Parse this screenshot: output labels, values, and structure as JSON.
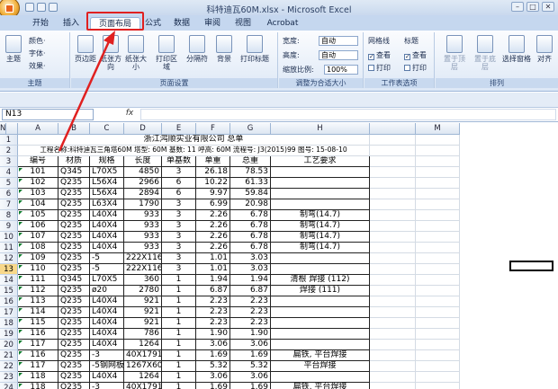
{
  "window": {
    "title": "科特迪瓦60M.xlsx - Microsoft Excel",
    "minimize": "–",
    "maximize": "□",
    "close": "✕"
  },
  "tabs": [
    "开始",
    "插入",
    "页面布局",
    "公式",
    "数据",
    "审阅",
    "视图",
    "Acrobat"
  ],
  "active_tab": "页面布局",
  "ribbon": {
    "theme": {
      "big": "主题",
      "colors": "颜色·",
      "fonts": "字体·",
      "effects": "效果·",
      "label": "主题"
    },
    "page_setup": {
      "margins": "页边距",
      "orientation": "纸张方向",
      "size": "纸张大小",
      "print_area": "打印区域",
      "breaks": "分隔符",
      "background": "背景",
      "print_titles": "打印标题",
      "label": "页面设置"
    },
    "scale": {
      "width_label": "宽度:",
      "width_value": "自动",
      "height_label": "高度:",
      "height_value": "自动",
      "zoom_label": "缩放比例:",
      "zoom_value": "100%",
      "label": "调整为合适大小"
    },
    "sheet_options": {
      "gridlines": "网格线",
      "headings": "标题",
      "view": "查看",
      "print": "打印",
      "label": "工作表选项"
    },
    "arrange": {
      "bring_forward": "置于顶层",
      "send_backward": "置于底层",
      "selection_pane": "选择窗格",
      "align": "对齐",
      "label": "排列"
    }
  },
  "formula_bar": {
    "name_box": "N13",
    "fx": "fx",
    "content": ""
  },
  "sheet": {
    "col_headers": [
      "A",
      "B",
      "C",
      "D",
      "E",
      "F",
      "G",
      "H",
      "",
      "M",
      "N"
    ],
    "row_headers": [
      "1",
      "2",
      "3",
      "4",
      "5",
      "6",
      "7",
      "8",
      "9",
      "10",
      "11",
      "12",
      "13",
      "14",
      "15",
      "16",
      "17",
      "18",
      "19",
      "20",
      "21",
      "22",
      "23",
      "24"
    ],
    "title": "浙江鸿顺实业有限公司   总单",
    "info": "工程名称:科特迪瓦三角塔60M  塔型: 60M 基数: 11 呼高: 60M 流程号: J3(2015)99 图号: 15-08-10",
    "headers": [
      "编号",
      "材质",
      "规格",
      "长度",
      "单基数",
      "单重",
      "总重",
      "工艺要求"
    ],
    "rows": [
      [
        "101",
        "Q345",
        "L70X5",
        "4850",
        "3",
        "26.18",
        "78.53",
        ""
      ],
      [
        "102",
        "Q235",
        "L56X4",
        "2966",
        "6",
        "10.22",
        "61.33",
        ""
      ],
      [
        "103",
        "Q235",
        "L56X4",
        "2894",
        "6",
        "9.97",
        "59.84",
        ""
      ],
      [
        "104",
        "Q235",
        "L63X4",
        "1790",
        "3",
        "6.99",
        "20.98",
        ""
      ],
      [
        "105",
        "Q235",
        "L40X4",
        "933",
        "3",
        "2.26",
        "6.78",
        "制弯(14.7)"
      ],
      [
        "106",
        "Q235",
        "L40X4",
        "933",
        "3",
        "2.26",
        "6.78",
        "制弯(14.7)"
      ],
      [
        "107",
        "Q235",
        "L40X4",
        "933",
        "3",
        "2.26",
        "6.78",
        "制弯(14.7)"
      ],
      [
        "108",
        "Q235",
        "L40X4",
        "933",
        "3",
        "2.26",
        "6.78",
        "制弯(14.7)"
      ],
      [
        "109",
        "Q235",
        "-5",
        "222X116",
        "3",
        "1.01",
        "3.03",
        ""
      ],
      [
        "110",
        "Q235",
        "-5",
        "222X116",
        "3",
        "1.01",
        "3.03",
        ""
      ],
      [
        "111",
        "Q345",
        "L70X5",
        "360",
        "1",
        "1.94",
        "1.94",
        "清根  焊接 (112)"
      ],
      [
        "112",
        "Q235",
        "ø20",
        "2780",
        "1",
        "6.87",
        "6.87",
        "焊接 (111)"
      ],
      [
        "113",
        "Q235",
        "L40X4",
        "921",
        "1",
        "2.23",
        "2.23",
        ""
      ],
      [
        "114",
        "Q235",
        "L40X4",
        "921",
        "1",
        "2.23",
        "2.23",
        ""
      ],
      [
        "115",
        "Q235",
        "L40X4",
        "921",
        "1",
        "2.23",
        "2.23",
        ""
      ],
      [
        "116",
        "Q235",
        "L40X4",
        "786",
        "1",
        "1.90",
        "1.90",
        ""
      ],
      [
        "117",
        "Q235",
        "L40X4",
        "1264",
        "1",
        "3.06",
        "3.06",
        ""
      ],
      [
        "116",
        "Q235",
        "-3",
        "40X1791",
        "1",
        "1.69",
        "1.69",
        "扁铁, 平台焊接"
      ],
      [
        "117",
        "Q235",
        "-5钢网板",
        "1267X600",
        "1",
        "5.32",
        "5.32",
        "平台焊接"
      ],
      [
        "118",
        "Q235",
        "L40X4",
        "1264",
        "1",
        "3.06",
        "3.06",
        ""
      ],
      [
        "118",
        "Q235",
        "-3",
        "40X1791",
        "1",
        "1.69",
        "1.69",
        "扁铁, 平台焊接"
      ]
    ]
  },
  "annotation_color": "#e02020"
}
